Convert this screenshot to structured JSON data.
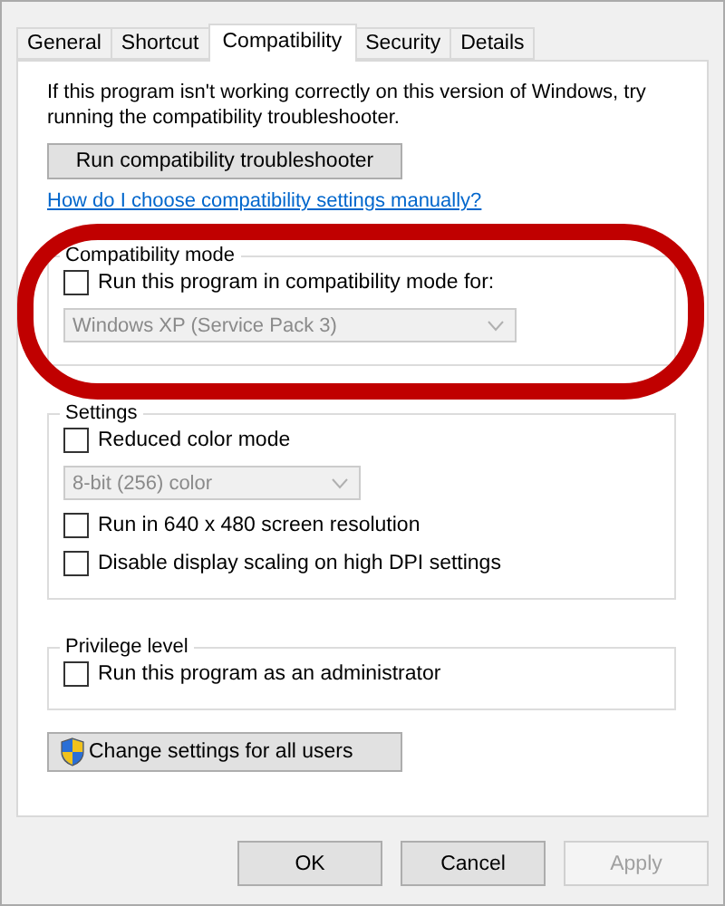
{
  "tabs": [
    {
      "label": "General",
      "selected": false
    },
    {
      "label": "Shortcut",
      "selected": false
    },
    {
      "label": "Compatibility",
      "selected": true
    },
    {
      "label": "Security",
      "selected": false
    },
    {
      "label": "Details",
      "selected": false
    }
  ],
  "intro": "If this program isn't working correctly on this version of Windows, try running the compatibility troubleshooter.",
  "troubleshooter_button": "Run compatibility troubleshooter",
  "help_link": "How do I choose compatibility settings manually?",
  "groups": [
    {
      "title": "Compatibility mode",
      "items": [
        {
          "kind": "checkbox",
          "label": "Run this program in compatibility mode for:",
          "checked": false
        },
        {
          "kind": "dropdown",
          "value": "Windows XP (Service Pack 3)",
          "disabled": true
        }
      ]
    },
    {
      "title": "Settings",
      "items": [
        {
          "kind": "checkbox",
          "label": "Reduced color mode",
          "checked": false
        },
        {
          "kind": "dropdown",
          "value": "8-bit (256) color",
          "disabled": true
        },
        {
          "kind": "checkbox",
          "label": "Run in 640 x 480 screen resolution",
          "checked": false
        },
        {
          "kind": "checkbox",
          "label": "Disable display scaling on high DPI settings",
          "checked": false
        }
      ]
    },
    {
      "title": "Privilege level",
      "items": [
        {
          "kind": "checkbox",
          "label": "Run this program as an administrator",
          "checked": false
        }
      ]
    }
  ],
  "all_users_button": "Change settings for all users",
  "buttons": [
    {
      "label": "OK",
      "disabled": false
    },
    {
      "label": "Cancel",
      "disabled": false
    },
    {
      "label": "Apply",
      "disabled": true
    }
  ]
}
